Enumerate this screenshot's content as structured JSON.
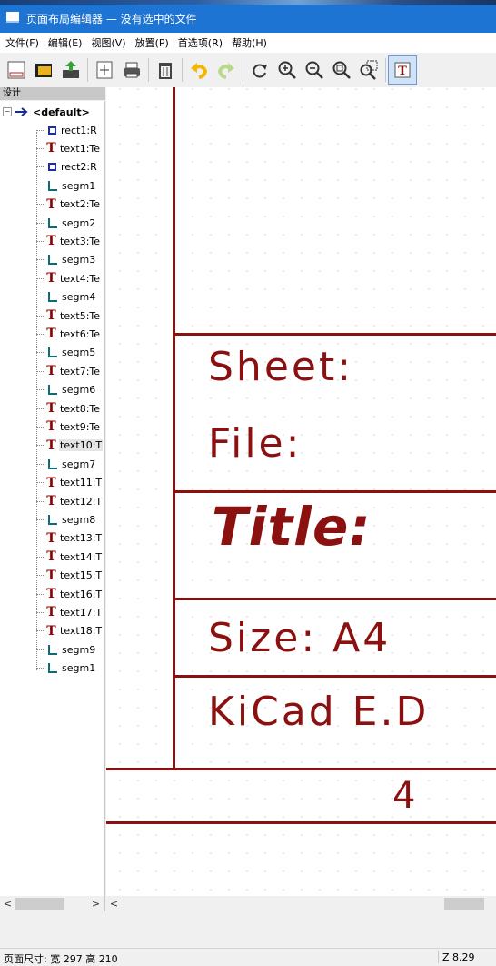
{
  "window": {
    "title": "页面布局编辑器 — 没有选中的文件"
  },
  "menu": [
    "文件(F)",
    "编辑(E)",
    "视图(V)",
    "放置(P)",
    "首选项(R)",
    "帮助(H)"
  ],
  "toolbar": {
    "buttons": [
      "new-page-icon",
      "open-folder-icon",
      "load-icon",
      "page-settings-icon",
      "print-icon",
      "delete-icon",
      "undo-icon",
      "redo-icon",
      "refresh-icon",
      "zoom-in-icon",
      "zoom-out-icon",
      "zoom-fit-icon",
      "zoom-selection-icon",
      "text-mode-icon"
    ]
  },
  "panel": {
    "label": "设计"
  },
  "tree": {
    "root": "<default>",
    "items": [
      {
        "label": "rect1:R",
        "type": "rect"
      },
      {
        "label": "text1:Te",
        "type": "text"
      },
      {
        "label": "rect2:R",
        "type": "rect"
      },
      {
        "label": "segm1",
        "type": "segm"
      },
      {
        "label": "text2:Te",
        "type": "text"
      },
      {
        "label": "segm2",
        "type": "segm"
      },
      {
        "label": "text3:Te",
        "type": "text"
      },
      {
        "label": "segm3",
        "type": "segm"
      },
      {
        "label": "text4:Te",
        "type": "text"
      },
      {
        "label": "segm4",
        "type": "segm"
      },
      {
        "label": "text5:Te",
        "type": "text"
      },
      {
        "label": "text6:Te",
        "type": "text"
      },
      {
        "label": "segm5",
        "type": "segm"
      },
      {
        "label": "text7:Te",
        "type": "text"
      },
      {
        "label": "segm6",
        "type": "segm"
      },
      {
        "label": "text8:Te",
        "type": "text"
      },
      {
        "label": "text9:Te",
        "type": "text"
      },
      {
        "label": "text10:T",
        "type": "text"
      },
      {
        "label": "segm7",
        "type": "segm"
      },
      {
        "label": "text11:T",
        "type": "text"
      },
      {
        "label": "text12:T",
        "type": "text"
      },
      {
        "label": "segm8",
        "type": "segm"
      },
      {
        "label": "text13:T",
        "type": "text"
      },
      {
        "label": "text14:T",
        "type": "text"
      },
      {
        "label": "text15:T",
        "type": "text"
      },
      {
        "label": "text16:T",
        "type": "text"
      },
      {
        "label": "text17:T",
        "type": "text"
      },
      {
        "label": "text18:T",
        "type": "text"
      },
      {
        "label": "segm9",
        "type": "segm"
      },
      {
        "label": "segm1",
        "type": "segm"
      }
    ]
  },
  "canvas": {
    "sheet_label": "Sheet:",
    "file_label": "File:",
    "title_label": "Title:",
    "size_label": "Size: A4",
    "kicad_label": "KiCad E.D",
    "grid_number": "4"
  },
  "scrollbars": {
    "left_arrow": "<",
    "right_arrow": ">"
  },
  "status": {
    "page_size": "页面尺寸: 宽 297 高 210",
    "zoom": "Z 8.29"
  },
  "colors": {
    "titlebar": "#1e74d2",
    "drawing": "#8b1010",
    "segment_icon": "#0f6b76",
    "rect_icon": "#1f2aa8"
  }
}
